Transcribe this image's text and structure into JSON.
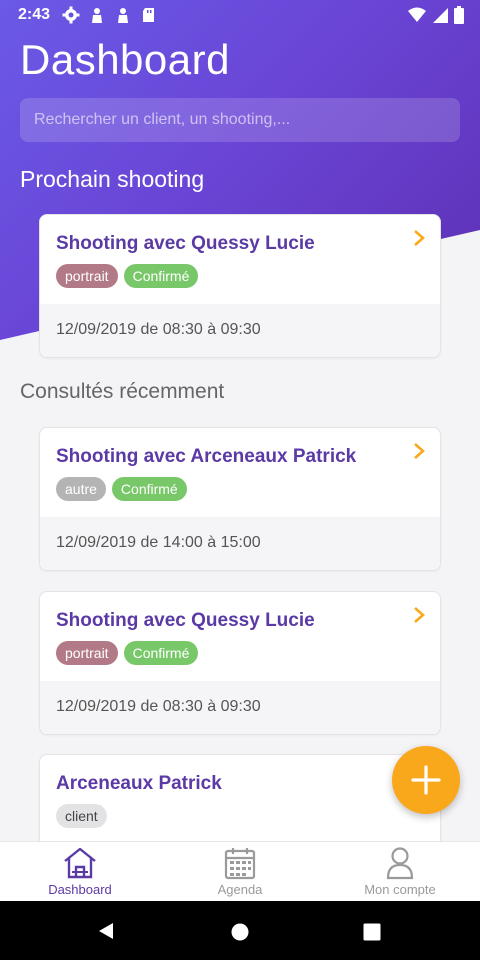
{
  "status": {
    "time": "2:43"
  },
  "header": {
    "title": "Dashboard",
    "search_placeholder": "Rechercher un client, un shooting,..."
  },
  "next": {
    "section_title": "Prochain shooting",
    "card": {
      "title": "Shooting avec Quessy Lucie",
      "tags": [
        "portrait",
        "Confirmé"
      ],
      "date": "12/09/2019 de 08:30 à 09:30"
    }
  },
  "recent": {
    "section_title": "Consultés récemment",
    "items": [
      {
        "title": "Shooting avec Arceneaux Patrick",
        "tags": [
          "autre",
          "Confirmé"
        ],
        "date": "12/09/2019 de 14:00 à 15:00"
      },
      {
        "title": "Shooting avec Quessy Lucie",
        "tags": [
          "portrait",
          "Confirmé"
        ],
        "date": "12/09/2019 de 08:30 à 09:30"
      },
      {
        "title": "Arceneaux Patrick",
        "tags": [
          "client"
        ]
      }
    ]
  },
  "nav": {
    "items": [
      {
        "label": "Dashboard",
        "icon": "home-icon"
      },
      {
        "label": "Agenda",
        "icon": "calendar-icon"
      },
      {
        "label": "Mon compte",
        "icon": "user-icon"
      }
    ]
  },
  "colors": {
    "accent": "#5b3aa6",
    "fab": "#f9a81b",
    "confirmed": "#78c768",
    "portrait": "#b27a86"
  }
}
